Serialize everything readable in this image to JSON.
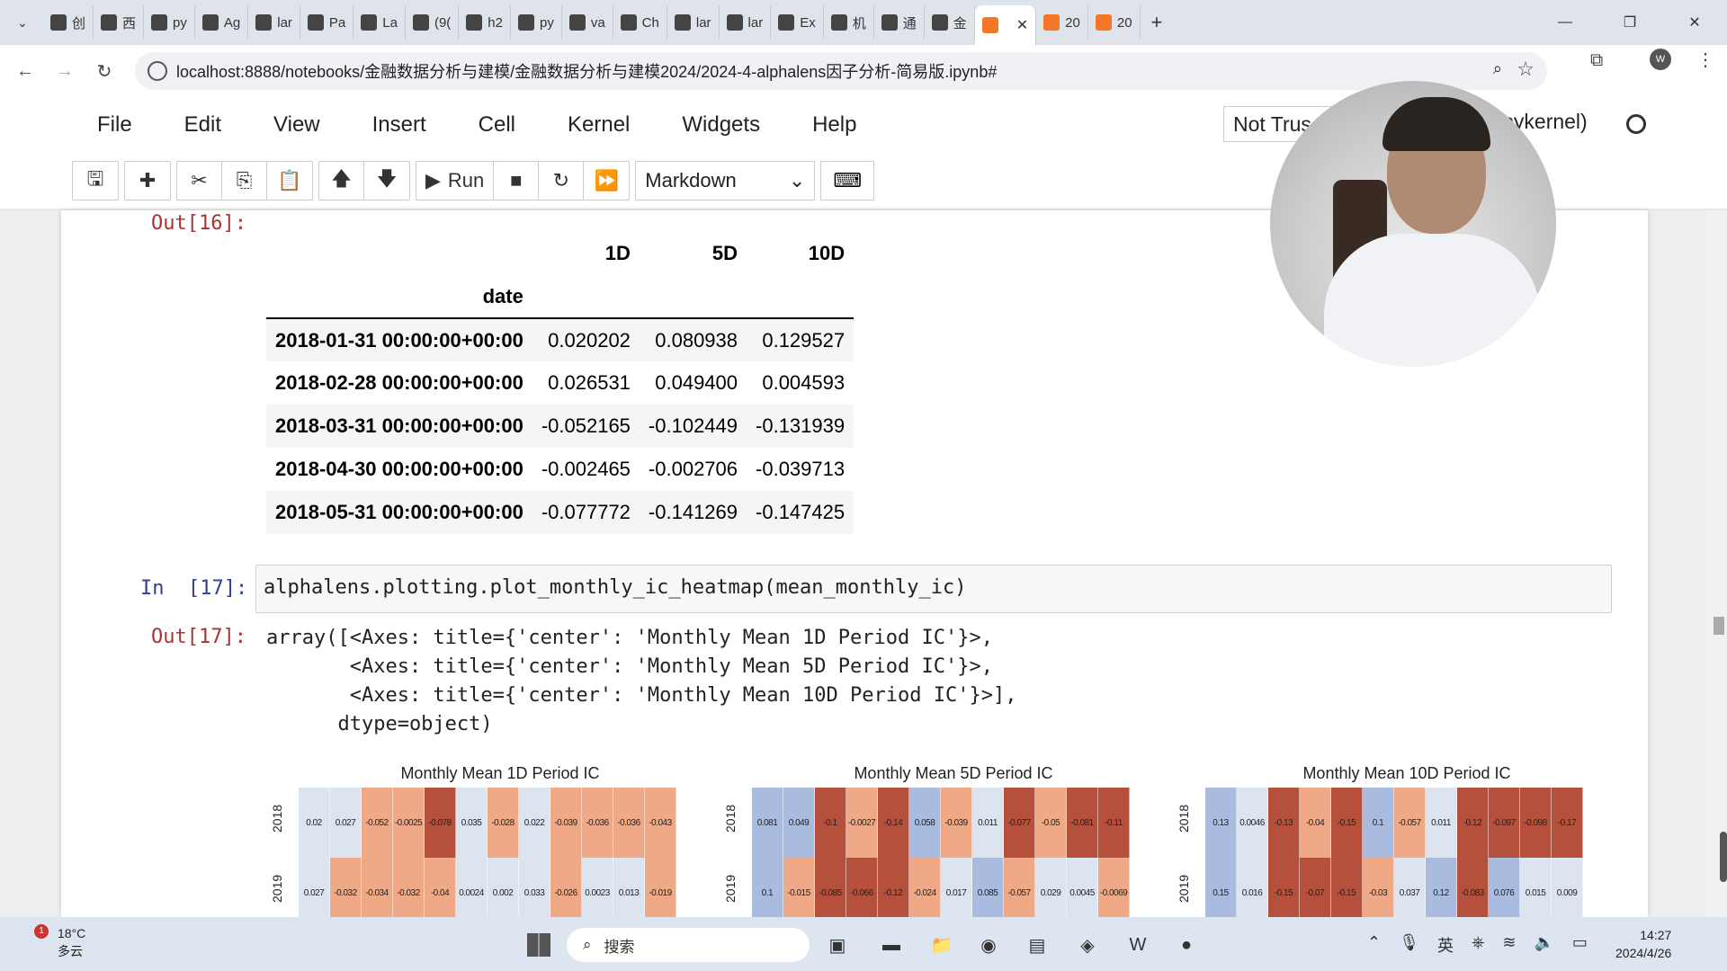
{
  "browser": {
    "tabs": [
      {
        "label": "创",
        "icon": "app-icon"
      },
      {
        "label": "西",
        "icon": "play-icon"
      },
      {
        "label": "py",
        "icon": "github-icon"
      },
      {
        "label": "Ag",
        "icon": "mail-icon"
      },
      {
        "label": "lar",
        "icon": "github-icon"
      },
      {
        "label": "Pa",
        "icon": "mail-icon"
      },
      {
        "label": "La",
        "icon": "ext-icon"
      },
      {
        "label": "(9(",
        "icon": "doc-icon"
      },
      {
        "label": "h2",
        "icon": "github-icon"
      },
      {
        "label": "py",
        "icon": "c-icon"
      },
      {
        "label": "va",
        "icon": "github-icon"
      },
      {
        "label": "Ch",
        "icon": "mail-icon"
      },
      {
        "label": "lar",
        "icon": "book-icon"
      },
      {
        "label": "lar",
        "icon": "book-icon"
      },
      {
        "label": "Ex",
        "icon": "cloud-icon"
      },
      {
        "label": "机",
        "icon": "o-icon"
      },
      {
        "label": "通",
        "icon": "wing-icon"
      },
      {
        "label": "金",
        "icon": "loading-icon"
      },
      {
        "label": "",
        "icon": "jupyter-icon",
        "active": true
      },
      {
        "label": "20",
        "icon": "jupyter-icon"
      },
      {
        "label": "20",
        "icon": "jupyter-icon"
      }
    ],
    "url": "localhost:8888/notebooks/金融数据分析与建模/金融数据分析与建模2024/2024-4-alphalens因子分析-简易版.ipynb#"
  },
  "jupyter": {
    "menu": [
      "File",
      "Edit",
      "View",
      "Insert",
      "Cell",
      "Kernel",
      "Widgets",
      "Help"
    ],
    "trusted": "Not Trus",
    "kernel": "ipykernel)",
    "run_label": "Run",
    "cell_type": "Markdown"
  },
  "out16": {
    "prompt": "Out[16]:",
    "columns": [
      "1D",
      "5D",
      "10D"
    ],
    "index_name": "date",
    "rows": [
      {
        "date": "2018-01-31 00:00:00+00:00",
        "v": [
          "0.020202",
          "0.080938",
          "0.129527"
        ]
      },
      {
        "date": "2018-02-28 00:00:00+00:00",
        "v": [
          "0.026531",
          "0.049400",
          "0.004593"
        ]
      },
      {
        "date": "2018-03-31 00:00:00+00:00",
        "v": [
          "-0.052165",
          "-0.102449",
          "-0.131939"
        ]
      },
      {
        "date": "2018-04-30 00:00:00+00:00",
        "v": [
          "-0.002465",
          "-0.002706",
          "-0.039713"
        ]
      },
      {
        "date": "2018-05-31 00:00:00+00:00",
        "v": [
          "-0.077772",
          "-0.141269",
          "-0.147425"
        ]
      }
    ]
  },
  "in17": {
    "prompt": "In  [17]:",
    "code": "alphalens.plotting.plot_monthly_ic_heatmap(mean_monthly_ic)"
  },
  "out17": {
    "prompt": "Out[17]:",
    "text": "array([<Axes: title={'center': 'Monthly Mean 1D Period IC'}>,\n       <Axes: title={'center': 'Monthly Mean 5D Period IC'}>,\n       <Axes: title={'center': 'Monthly Mean 10D Period IC'}>],\n      dtype=object)"
  },
  "chart_data": [
    {
      "type": "heatmap",
      "title": "Monthly Mean 1D Period IC",
      "y": [
        "2018",
        "2019"
      ],
      "values": [
        [
          "0.02",
          "0.027",
          "-0.052",
          "-0.0025",
          "-0.078",
          "0.035",
          "-0.028",
          "0.022",
          "-0.039",
          "-0.036",
          "-0.036",
          "-0.043"
        ],
        [
          "0.027",
          "-0.032",
          "-0.034",
          "-0.032",
          "-0.04",
          "0.0024",
          "0.002",
          "0.033",
          "-0.026",
          "0.0023",
          "0.013",
          "-0.019"
        ]
      ]
    },
    {
      "type": "heatmap",
      "title": "Monthly Mean 5D Period IC",
      "y": [
        "2018",
        "2019"
      ],
      "values": [
        [
          "0.081",
          "0.049",
          "-0.1",
          "-0.0027",
          "-0.14",
          "0.058",
          "-0.039",
          "0.011",
          "-0.077",
          "-0.05",
          "-0.081",
          "-0.11"
        ],
        [
          "0.1",
          "-0.015",
          "-0.085",
          "-0.066",
          "-0.12",
          "-0.024",
          "0.017",
          "0.085",
          "-0.057",
          "0.029",
          "0.0045",
          "-0.0069"
        ]
      ]
    },
    {
      "type": "heatmap",
      "title": "Monthly Mean 10D Period IC",
      "y": [
        "2018",
        "2019"
      ],
      "values": [
        [
          "0.13",
          "0.0046",
          "-0.13",
          "-0.04",
          "-0.15",
          "0.1",
          "-0.057",
          "0.011",
          "-0.12",
          "-0.097",
          "-0.098",
          "-0.17"
        ],
        [
          "0.15",
          "0.016",
          "-0.15",
          "-0.07",
          "-0.15",
          "-0.03",
          "0.037",
          "0.12",
          "-0.083",
          "0.076",
          "0.015",
          "0.009"
        ]
      ]
    }
  ],
  "taskbar": {
    "temp": "18°C",
    "weather": "多云",
    "badge": "1",
    "search": "搜索",
    "time": "14:27",
    "date": "2024/4/26"
  },
  "colors": {
    "negative": "#f0a986",
    "positive": "#a9bcdf",
    "strong_negative": "#b5503c",
    "neutral": "#dbe4ef"
  }
}
